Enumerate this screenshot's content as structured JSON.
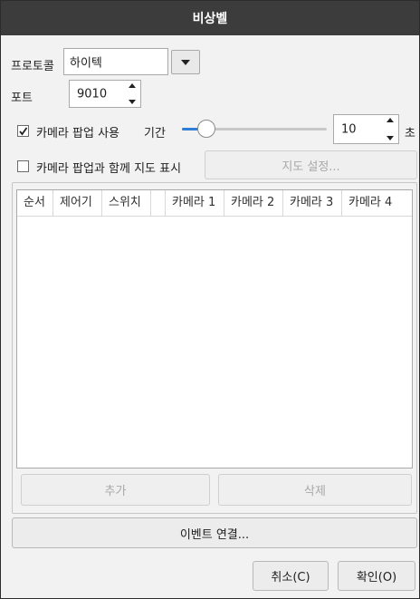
{
  "window": {
    "title": "비상벨"
  },
  "protocol": {
    "label": "프로토콜",
    "value": "하이텍"
  },
  "port": {
    "label": "포트",
    "value": "9010"
  },
  "camera_popup": {
    "checkbox_label": "카메라 팝업 사용",
    "checked": true,
    "duration_label": "기간",
    "duration_value": "10",
    "duration_unit": "초",
    "slider_level": 0.17
  },
  "map_popup": {
    "checkbox_label": "카메라 팝업과 함께 지도 표시",
    "checked": false,
    "settings_button": "지도 설정..."
  },
  "table": {
    "columns": [
      "순서",
      "제어기",
      "스위치",
      "",
      "카메라 1",
      "카메라 2",
      "카메라 3",
      "카메라 4"
    ],
    "rows": []
  },
  "actions": {
    "add": "추가",
    "delete": "삭제"
  },
  "event_link_button": "이벤트 연결...",
  "footer": {
    "cancel": "취소(C)",
    "ok": "확인(O)"
  },
  "colors": {
    "titlebar": "#3c3c3c",
    "accent": "#2f7fd8"
  }
}
